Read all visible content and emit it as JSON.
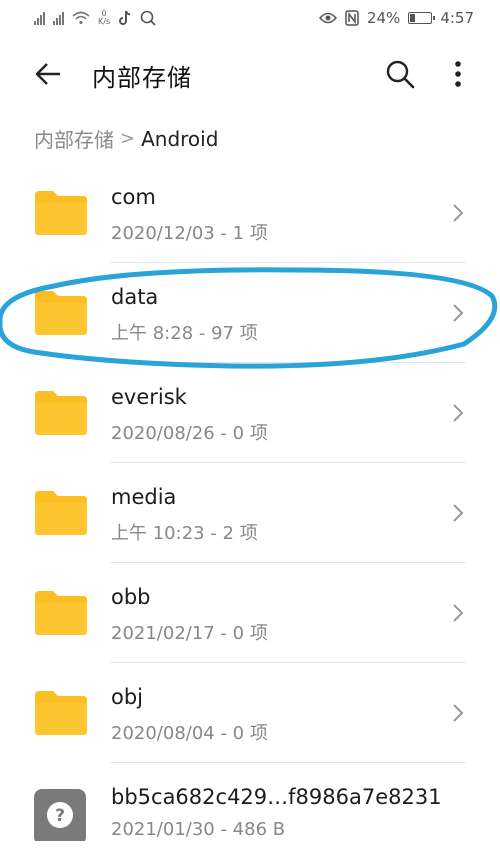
{
  "status_bar": {
    "netspeed_value": "0",
    "netspeed_unit": "K/s",
    "battery": "24%",
    "time": "4:57"
  },
  "app_bar": {
    "title": "内部存储"
  },
  "breadcrumb": {
    "root": "内部存储",
    "separator": ">",
    "current": "Android"
  },
  "files": [
    {
      "name": "com",
      "meta": "2020/12/03 - 1 项",
      "type": "folder"
    },
    {
      "name": "data",
      "meta": "上午 8:28  - 97 项",
      "type": "folder"
    },
    {
      "name": "everisk",
      "meta": "2020/08/26 - 0 项",
      "type": "folder"
    },
    {
      "name": "media",
      "meta": "上午 10:23  - 2 项",
      "type": "folder"
    },
    {
      "name": "obb",
      "meta": "2021/02/17 - 0 项",
      "type": "folder"
    },
    {
      "name": "obj",
      "meta": "2020/08/04 - 0 项",
      "type": "folder"
    },
    {
      "name": "bb5ca682c429…f8986a7e8231",
      "meta": "2021/01/30 - 486 B",
      "type": "unknown-file"
    }
  ],
  "colors": {
    "folder": "#FBBF24",
    "folder_tab": "#F9B915",
    "unknown_file": "#7a7a7a",
    "annotation": "#2AA3D9"
  }
}
